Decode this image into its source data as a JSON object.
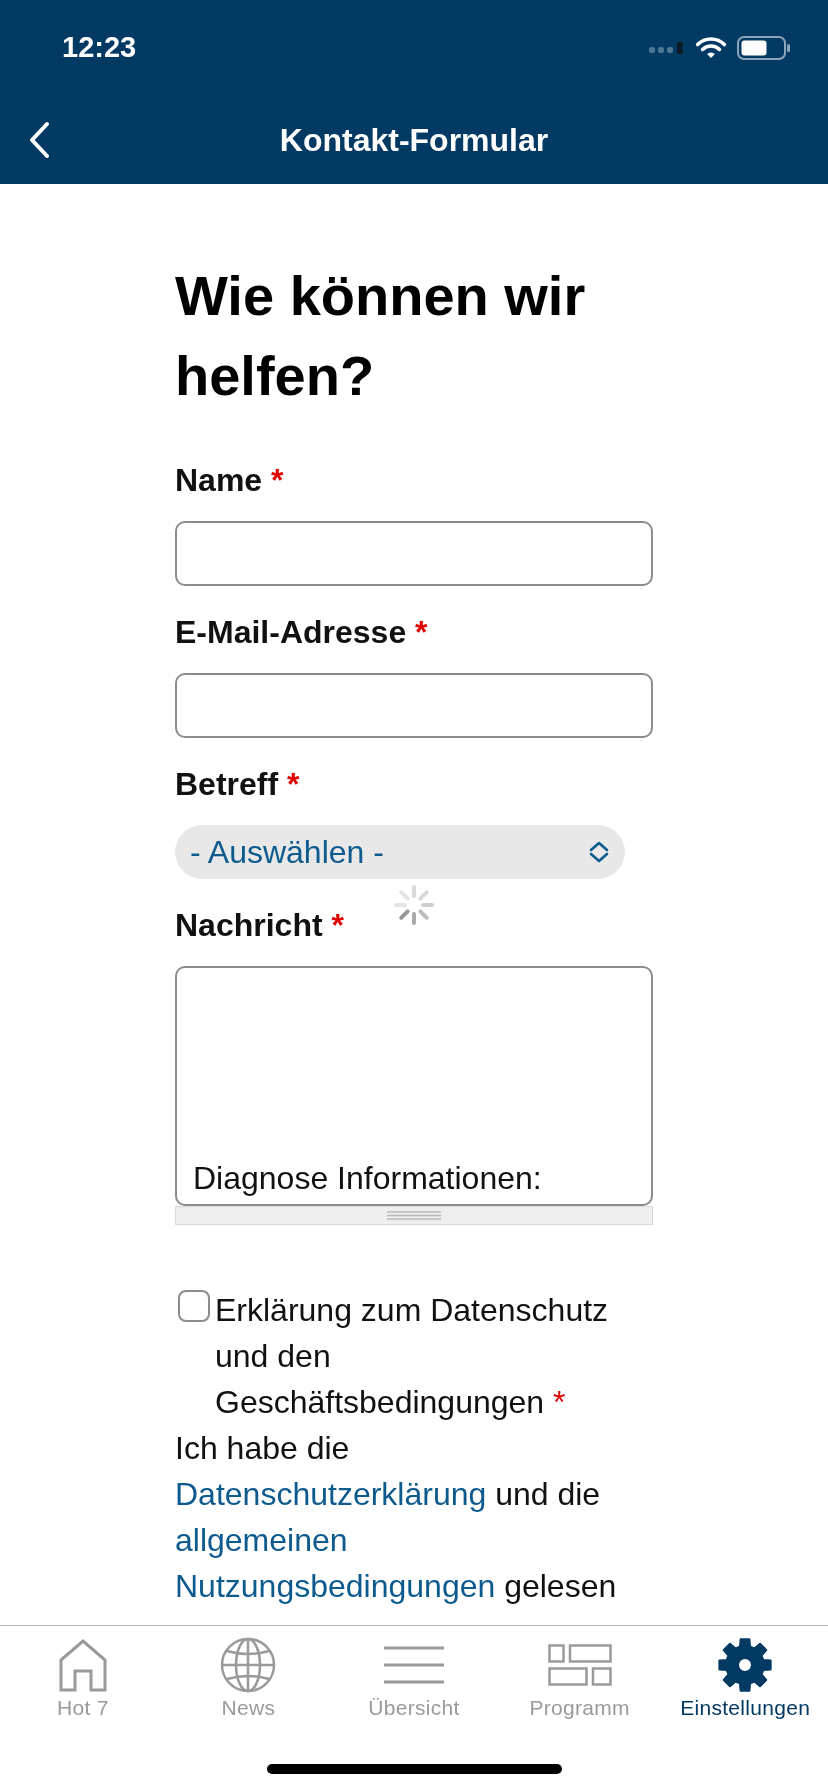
{
  "status_bar": {
    "time": "12:23"
  },
  "nav_bar": {
    "title": "Kontakt-Formular"
  },
  "form": {
    "heading": "Wie können wir helfen?",
    "fields": [
      {
        "kind": "input",
        "label": "Name",
        "required_mark": "*"
      },
      {
        "kind": "input",
        "label": "E-Mail-Adresse",
        "required_mark": "*"
      },
      {
        "kind": "select",
        "label": "Betreff",
        "required_mark": "*",
        "value": "- Auswählen -"
      },
      {
        "kind": "textarea",
        "label": "Nachricht",
        "required_mark": "*",
        "value": "Diagnose Informationen:"
      }
    ],
    "consent": {
      "checked": false,
      "label": "Erklärung zum Datenschutz und den Geschäftsbedingungen",
      "required_mark": "*",
      "text": [
        {
          "kind": "text",
          "text": "Ich habe die"
        },
        {
          "kind": "link",
          "text": "Datenschutzerklärung"
        },
        {
          "kind": "text",
          "text": "und die"
        },
        {
          "kind": "link",
          "text": "allgemeinen Nutzungsbedingungen"
        },
        {
          "kind": "text",
          "text": "gelesen"
        }
      ]
    }
  },
  "tab_bar": {
    "items": [
      {
        "label": "Hot 7",
        "selected": false
      },
      {
        "label": "News",
        "selected": false
      },
      {
        "label": "Übersicht",
        "selected": false
      },
      {
        "label": "Programm",
        "selected": false
      },
      {
        "label": "Einstellungen",
        "selected": true
      }
    ]
  }
}
